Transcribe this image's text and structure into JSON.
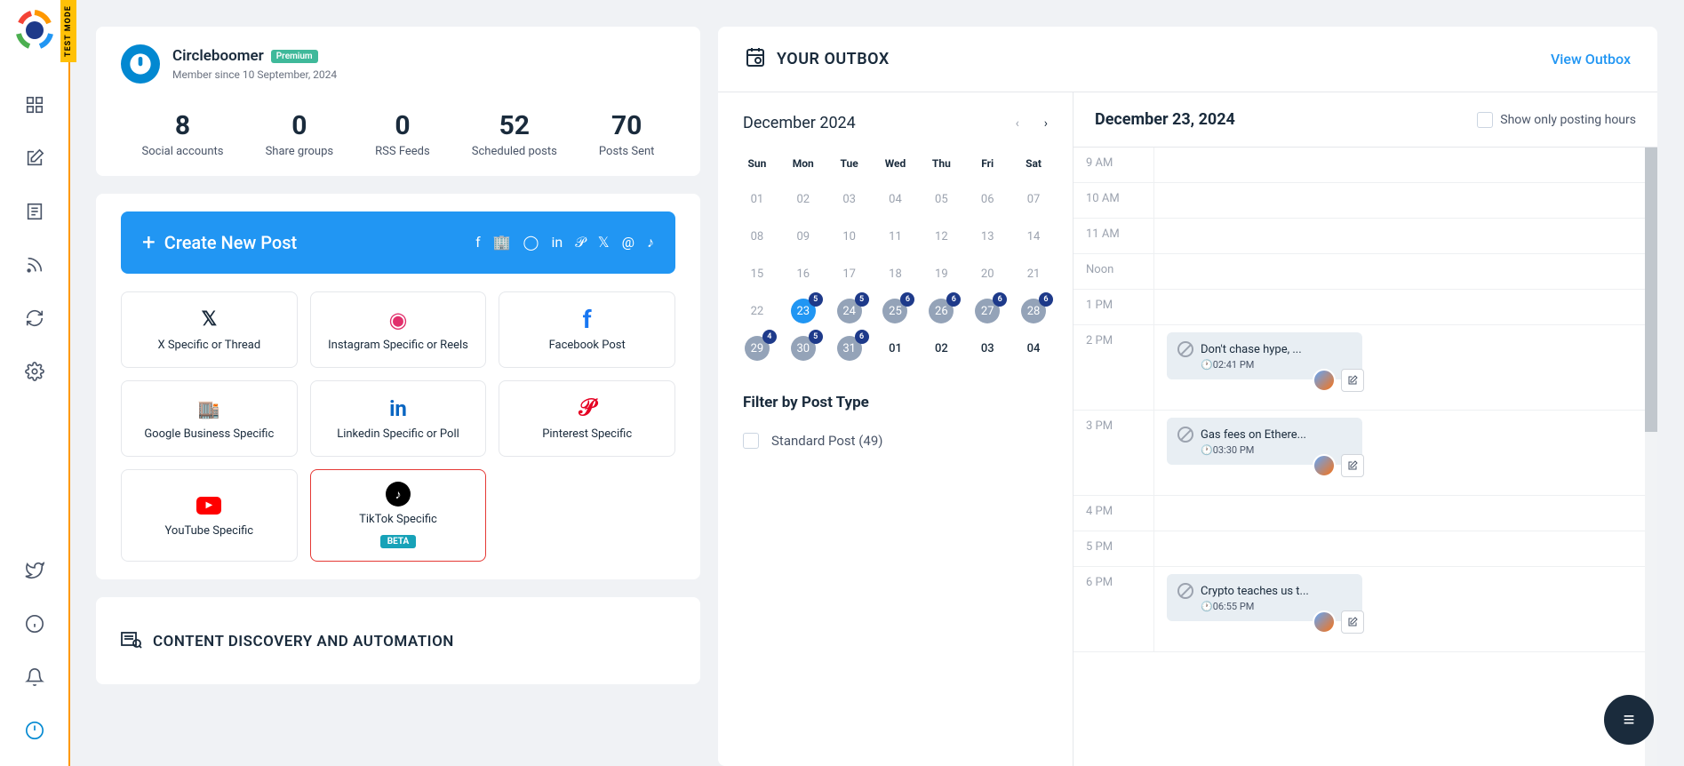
{
  "test_mode": "TEST MODE",
  "profile": {
    "name": "Circleboomer",
    "badge": "Premium",
    "member": "Member since 10 September, 2024"
  },
  "stats": [
    {
      "n": "8",
      "l": "Social accounts"
    },
    {
      "n": "0",
      "l": "Share groups"
    },
    {
      "n": "0",
      "l": "RSS Feeds"
    },
    {
      "n": "52",
      "l": "Scheduled posts"
    },
    {
      "n": "70",
      "l": "Posts Sent"
    }
  ],
  "create": {
    "title": "Create New Post"
  },
  "tiles": [
    {
      "label": "X Specific or Thread",
      "icon": "x"
    },
    {
      "label": "Instagram Specific or Reels",
      "icon": "ig"
    },
    {
      "label": "Facebook Post",
      "icon": "fb"
    },
    {
      "label": "Google Business Specific",
      "icon": "gb"
    },
    {
      "label": "Linkedin Specific or Poll",
      "icon": "li"
    },
    {
      "label": "Pinterest Specific",
      "icon": "pin"
    },
    {
      "label": "YouTube Specific",
      "icon": "yt"
    },
    {
      "label": "TikTok Specific",
      "icon": "tk",
      "beta": "BETA",
      "hl": true
    }
  ],
  "content_section": "CONTENT DISCOVERY AND AUTOMATION",
  "outbox": {
    "title": "YOUR OUTBOX",
    "view": "View Outbox"
  },
  "cal": {
    "month": "December 2024",
    "dow": [
      "Sun",
      "Mon",
      "Tue",
      "Wed",
      "Thu",
      "Fri",
      "Sat"
    ],
    "weeks": [
      [
        {
          "d": "01",
          "m": true
        },
        {
          "d": "02",
          "m": true
        },
        {
          "d": "03",
          "m": true
        },
        {
          "d": "04",
          "m": true
        },
        {
          "d": "05",
          "m": true
        },
        {
          "d": "06",
          "m": true
        },
        {
          "d": "07",
          "m": true
        }
      ],
      [
        {
          "d": "08",
          "m": true
        },
        {
          "d": "09",
          "m": true
        },
        {
          "d": "10",
          "m": true
        },
        {
          "d": "11",
          "m": true
        },
        {
          "d": "12",
          "m": true
        },
        {
          "d": "13",
          "m": true
        },
        {
          "d": "14",
          "m": true
        }
      ],
      [
        {
          "d": "15",
          "m": true
        },
        {
          "d": "16",
          "m": true
        },
        {
          "d": "17",
          "m": true
        },
        {
          "d": "18",
          "m": true
        },
        {
          "d": "19",
          "m": true
        },
        {
          "d": "20",
          "m": true
        },
        {
          "d": "21",
          "m": true
        }
      ],
      [
        {
          "d": "22",
          "m": true
        },
        {
          "d": "23",
          "a": true,
          "b": "5"
        },
        {
          "d": "24",
          "g": true,
          "b": "5"
        },
        {
          "d": "25",
          "g": true,
          "b": "6"
        },
        {
          "d": "26",
          "g": true,
          "b": "6"
        },
        {
          "d": "27",
          "g": true,
          "b": "6"
        },
        {
          "d": "28",
          "g": true,
          "b": "6"
        }
      ],
      [
        {
          "d": "29",
          "g": true,
          "b": "4"
        },
        {
          "d": "30",
          "g": true,
          "b": "5"
        },
        {
          "d": "31",
          "g": true,
          "b": "6"
        },
        {
          "d": "01",
          "p": true
        },
        {
          "d": "02",
          "p": true
        },
        {
          "d": "03",
          "p": true
        },
        {
          "d": "04",
          "p": true
        }
      ]
    ]
  },
  "filter": {
    "title": "Filter by Post Type",
    "items": [
      {
        "l": "Standard Post (49)"
      }
    ]
  },
  "tl": {
    "date": "December 23, 2024",
    "opt": "Show only posting hours",
    "hours": [
      "9 AM",
      "10 AM",
      "11 AM",
      "Noon",
      "1 PM",
      "2 PM",
      "3 PM",
      "4 PM",
      "5 PM",
      "6 PM"
    ],
    "posts": {
      "2 PM": {
        "text": "Don't chase hype, ...",
        "time": "02:41 PM"
      },
      "3 PM": {
        "text": "Gas fees on Ethere...",
        "time": "03:30 PM"
      },
      "6 PM": {
        "text": "Crypto teaches us t...",
        "time": "06:55 PM"
      }
    }
  }
}
